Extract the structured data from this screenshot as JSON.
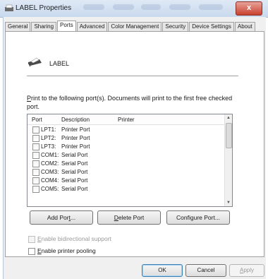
{
  "window": {
    "title": "LABEL Properties",
    "close": "x"
  },
  "tabs": [
    {
      "label": "General"
    },
    {
      "label": "Sharing"
    },
    {
      "label": "Ports"
    },
    {
      "label": "Advanced"
    },
    {
      "label": "Color Management"
    },
    {
      "label": "Security"
    },
    {
      "label": "Device Settings"
    },
    {
      "label": "About"
    }
  ],
  "active_tab": "Ports",
  "printer": {
    "name": "LABEL",
    "icon": "printer-icon"
  },
  "instructions": {
    "accel": "P",
    "rest": "rint to the following port(s). Documents will print to the first free checked port."
  },
  "port_list": {
    "columns": [
      "Port",
      "Description",
      "Printer"
    ],
    "rows": [
      {
        "port": "LPT1:",
        "description": "Printer Port",
        "printer": ""
      },
      {
        "port": "LPT2:",
        "description": "Printer Port",
        "printer": ""
      },
      {
        "port": "LPT3:",
        "description": "Printer Port",
        "printer": ""
      },
      {
        "port": "COM1:",
        "description": "Serial Port",
        "printer": ""
      },
      {
        "port": "COM2:",
        "description": "Serial Port",
        "printer": ""
      },
      {
        "port": "COM3:",
        "description": "Serial Port",
        "printer": ""
      },
      {
        "port": "COM4:",
        "description": "Serial Port",
        "printer": ""
      },
      {
        "port": "COM5:",
        "description": "Serial Port",
        "printer": ""
      }
    ]
  },
  "buttons": {
    "add_port": {
      "pre": "Add Por",
      "accel": "t",
      "post": "..."
    },
    "delete_port": {
      "pre": "",
      "accel": "D",
      "post": "elete Port"
    },
    "configure_port": {
      "pre": "",
      "accel": "",
      "post": "Configure Port..."
    }
  },
  "options": {
    "bidirectional": {
      "accel": "E",
      "rest": "nable bidirectional support",
      "enabled": false
    },
    "pooling": {
      "accel": "E",
      "rest": "nable printer pooling",
      "enabled": true
    }
  },
  "dialog_buttons": {
    "ok": "OK",
    "cancel": "Cancel",
    "apply": {
      "accel": "A",
      "rest": "pply"
    }
  }
}
